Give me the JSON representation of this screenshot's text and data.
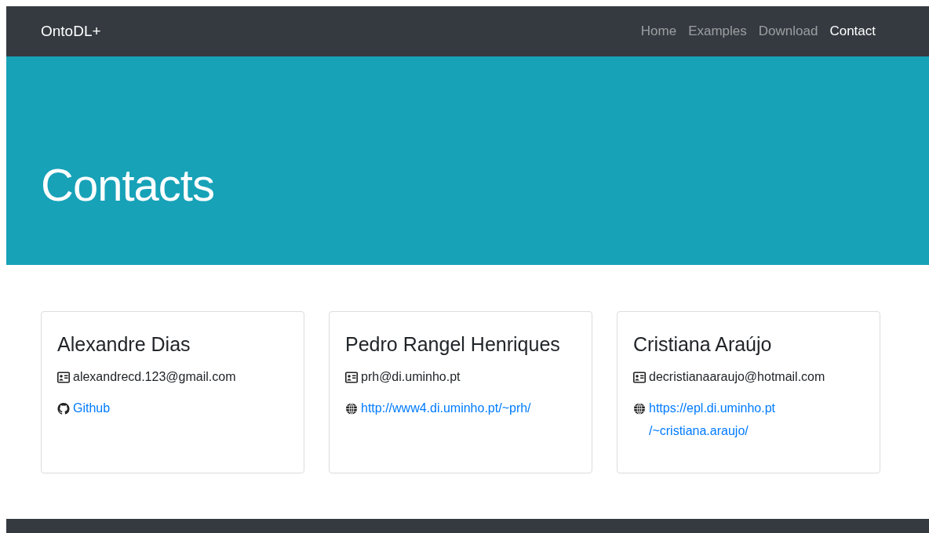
{
  "navbar": {
    "brand": "OntoDL+",
    "links": [
      {
        "label": "Home",
        "selected": false
      },
      {
        "label": "Examples",
        "selected": false
      },
      {
        "label": "Download",
        "selected": false
      },
      {
        "label": "Contact",
        "selected": true
      }
    ]
  },
  "hero": {
    "title": "Contacts"
  },
  "contacts": [
    {
      "name": "Alexandre Dias",
      "email": "alexandrecd.123@gmail.com",
      "link": {
        "kind": "github",
        "lines": [
          "Github"
        ]
      }
    },
    {
      "name": "Pedro Rangel Henriques",
      "email": "prh@di.uminho.pt",
      "link": {
        "kind": "web",
        "lines": [
          "http://www4.di.uminho.pt/~prh/"
        ]
      }
    },
    {
      "name": "Cristiana Araújo",
      "email": "decristianaaraujo@hotmail.com",
      "link": {
        "kind": "web",
        "lines": [
          "https://epl.di.uminho.pt",
          "/~cristiana.araujo/"
        ]
      }
    }
  ]
}
